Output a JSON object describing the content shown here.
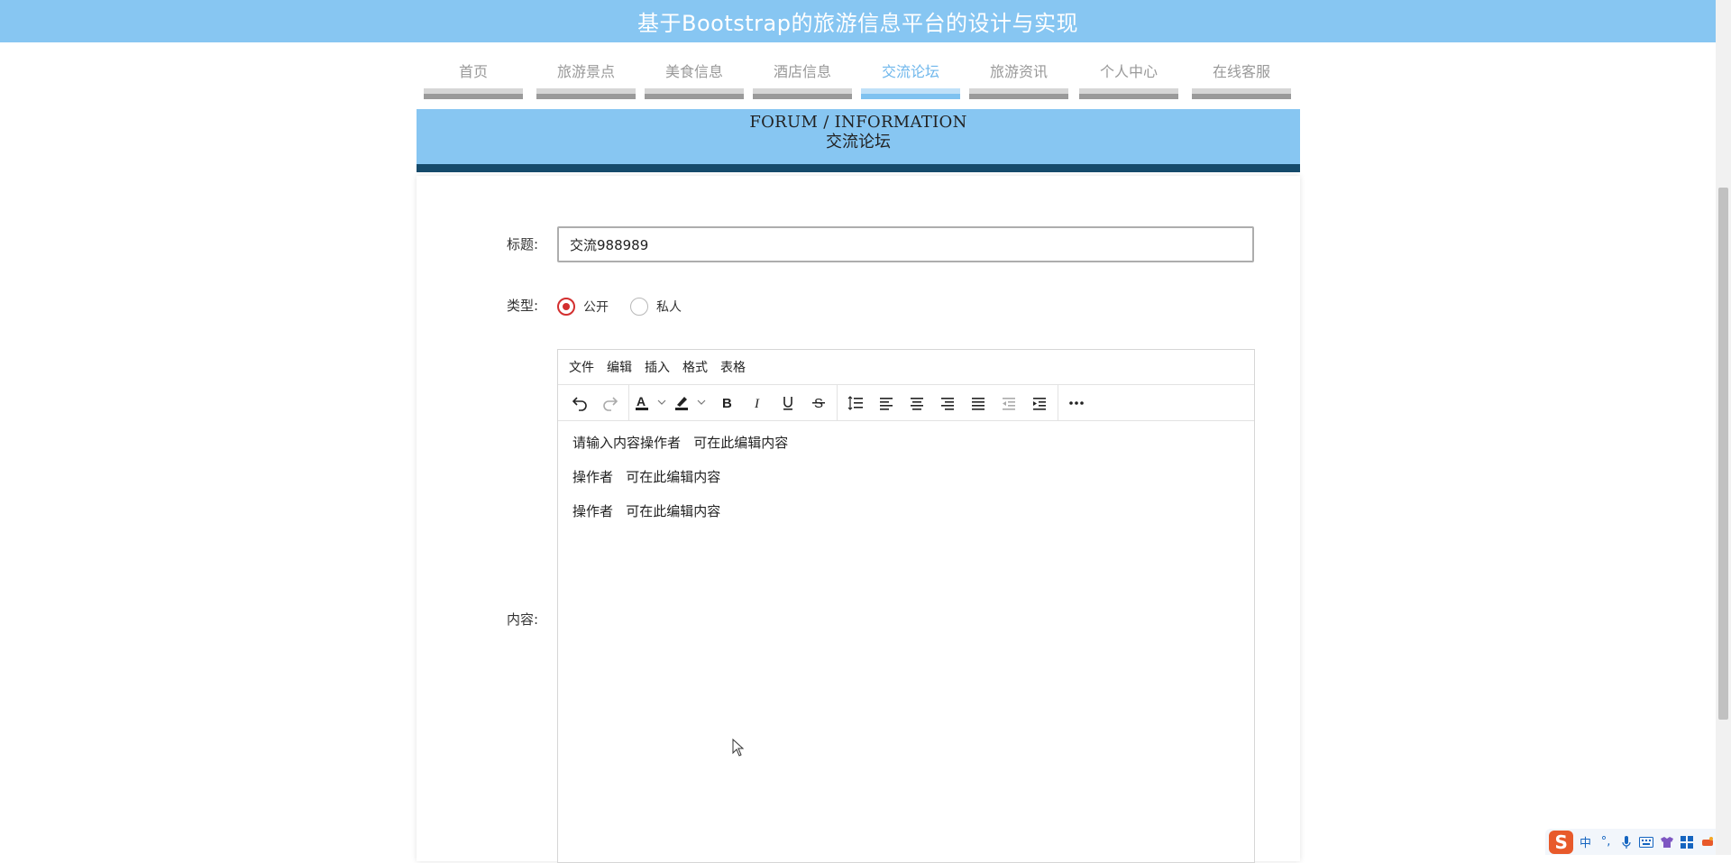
{
  "header": {
    "title": "基于Bootstrap的旅游信息平台的设计与实现"
  },
  "nav": {
    "items": [
      {
        "label": "首页",
        "active": false
      },
      {
        "label": "旅游景点",
        "active": false
      },
      {
        "label": "美食信息",
        "active": false
      },
      {
        "label": "酒店信息",
        "active": false
      },
      {
        "label": "交流论坛",
        "active": true
      },
      {
        "label": "旅游资讯",
        "active": false
      },
      {
        "label": "个人中心",
        "active": false
      },
      {
        "label": "在线客服",
        "active": false
      }
    ]
  },
  "banner": {
    "en": "FORUM / INFORMATION",
    "cn": "交流论坛"
  },
  "form": {
    "title_label": "标题:",
    "title_value": "交流988989",
    "type_label": "类型:",
    "type_options": [
      {
        "label": "公开",
        "checked": true
      },
      {
        "label": "私人",
        "checked": false
      }
    ],
    "content_label": "内容:"
  },
  "editor": {
    "menu": [
      "文件",
      "编辑",
      "插入",
      "格式",
      "表格"
    ],
    "toolbar_icons": [
      "undo-icon",
      "redo-icon",
      "text-color-icon",
      "highlight-color-icon",
      "bold-icon",
      "italic-icon",
      "underline-icon",
      "strikethrough-icon",
      "line-height-icon",
      "align-left-icon",
      "align-center-icon",
      "align-right-icon",
      "justify-icon",
      "outdent-icon",
      "indent-icon",
      "more-icon"
    ],
    "lines": [
      "请输入内容操作者   可在此编辑内容",
      "操作者   可在此编辑内容",
      "操作者   可在此编辑内容"
    ]
  },
  "ime": {
    "logo": "S",
    "mode": "中"
  },
  "colors": {
    "accent": "#87c6f2",
    "banner_border": "#154a6b",
    "radio_checked": "#d32f2f"
  }
}
